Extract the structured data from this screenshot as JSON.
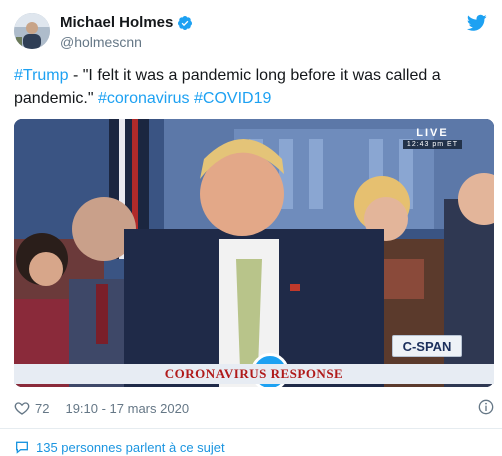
{
  "author": {
    "display_name": "Michael Holmes",
    "handle": "@holmescnn",
    "verified": true
  },
  "tweet": {
    "hashtag_1": "#Trump",
    "text_1": " -   \"I felt it was a pandemic long before it was called a pandemic.\" ",
    "hashtag_2": "#coronavirus",
    "hashtag_3": "#COVID19"
  },
  "video": {
    "live_label": "LIVE",
    "live_time": "12:43 pm ET",
    "network_logo": "C-SPAN",
    "banner_text": "CORONAVIRUS RESPONSE",
    "play_icon": "play-icon"
  },
  "meta": {
    "likes": "72",
    "timestamp": "19:10 - 17 mars 2020"
  },
  "footer": {
    "conversation_label": "135 personnes parlent à ce sujet"
  },
  "colors": {
    "accent": "#1da1f2",
    "text": "#14171a",
    "muted": "#657786",
    "banner_red": "#b01a1a"
  }
}
